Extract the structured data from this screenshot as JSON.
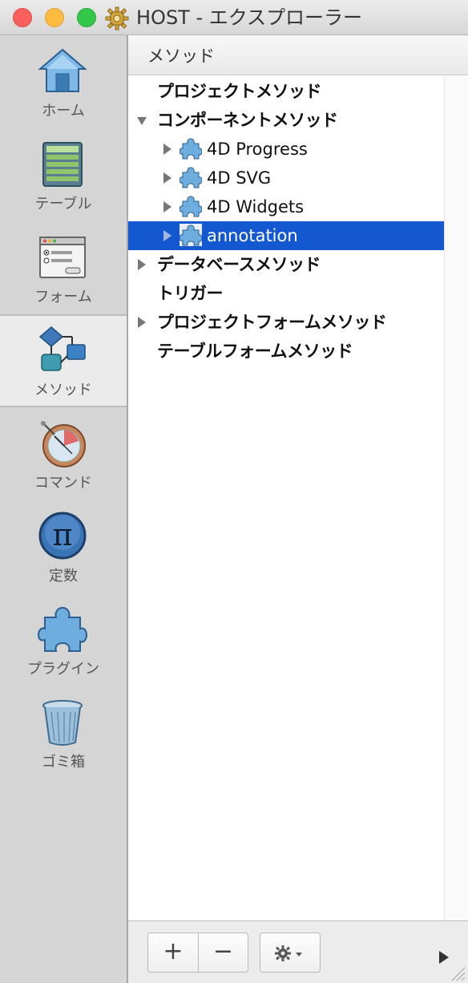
{
  "window": {
    "title": "HOST - エクスプローラー"
  },
  "sidebar": {
    "items": [
      {
        "label": "ホーム",
        "icon": "home-icon"
      },
      {
        "label": "テーブル",
        "icon": "table-icon"
      },
      {
        "label": "フォーム",
        "icon": "form-icon"
      },
      {
        "label": "メソッド",
        "icon": "method-icon"
      },
      {
        "label": "コマンド",
        "icon": "command-icon"
      },
      {
        "label": "定数",
        "icon": "pi-icon"
      },
      {
        "label": "プラグイン",
        "icon": "puzzle-icon"
      },
      {
        "label": "ゴミ箱",
        "icon": "trash-icon"
      }
    ]
  },
  "main": {
    "header": "メソッド",
    "tree": [
      {
        "label": "プロジェクトメソッド"
      },
      {
        "label": "コンポーネントメソッド"
      },
      {
        "label": "4D Progress"
      },
      {
        "label": "4D SVG"
      },
      {
        "label": "4D Widgets"
      },
      {
        "label": "annotation"
      },
      {
        "label": "データベースメソッド"
      },
      {
        "label": "トリガー"
      },
      {
        "label": "プロジェクトフォームメソッド"
      },
      {
        "label": "テーブルフォームメソッド"
      }
    ]
  },
  "toolbar": {
    "add_label": "+",
    "remove_label": "−"
  },
  "colors": {
    "selection": "#1358d0",
    "sidebar_bg": "#d5d5d5"
  }
}
